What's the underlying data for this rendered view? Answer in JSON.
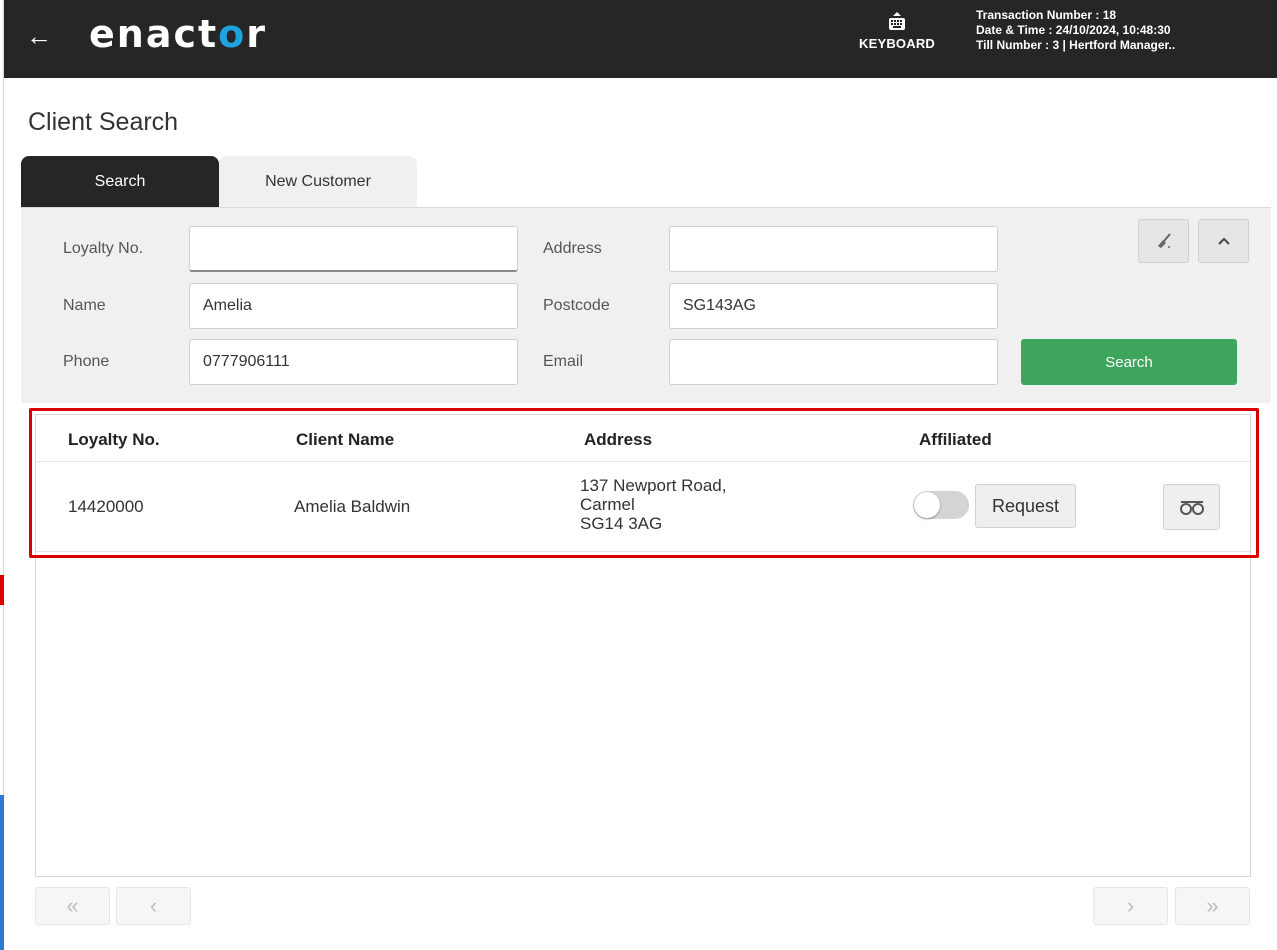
{
  "header": {
    "back_icon": "back-arrow-icon",
    "brand_prefix": "enact",
    "brand_o": "o",
    "brand_suffix": "r",
    "keyboard_label": "KEYBOARD",
    "transaction_line": "Transaction Number : 18",
    "datetime_line": "Date & Time : 24/10/2024, 10:48:30",
    "till_line": "Till Number : 3  |  Hertford Manager.."
  },
  "page": {
    "title": "Client Search"
  },
  "tabs": [
    {
      "label": "Search",
      "active": true
    },
    {
      "label": "New Customer",
      "active": false
    }
  ],
  "form": {
    "loyalty_label": "Loyalty No.",
    "loyalty_value": "",
    "name_label": "Name",
    "name_value": "Amelia",
    "phone_label": "Phone",
    "phone_value": "0777906111",
    "address_label": "Address",
    "address_value": "",
    "postcode_label": "Postcode",
    "postcode_value": "SG143AG",
    "email_label": "Email",
    "email_value": "",
    "search_button": "Search",
    "clear_icon": "broom-icon",
    "collapse_icon": "chevron-up-icon"
  },
  "results": {
    "columns": [
      "Loyalty No.",
      "Client Name",
      "Address",
      "Affiliated"
    ],
    "rows": [
      {
        "loyalty_no": "14420000",
        "client_name": "Amelia Baldwin",
        "address_line1": "137 Newport Road,",
        "address_line2": "Carmel",
        "address_line3": "SG14 3AG",
        "affiliated": false,
        "request_label": "Request",
        "view_icon": "glasses-icon"
      }
    ]
  },
  "pagination": {
    "first": "«",
    "prev": "‹",
    "next": "›",
    "last": "»"
  },
  "colors": {
    "header_bg": "#262626",
    "accent_blue": "#1fa3e0",
    "search_green": "#3ea55c",
    "highlight_red": "#d90000"
  }
}
